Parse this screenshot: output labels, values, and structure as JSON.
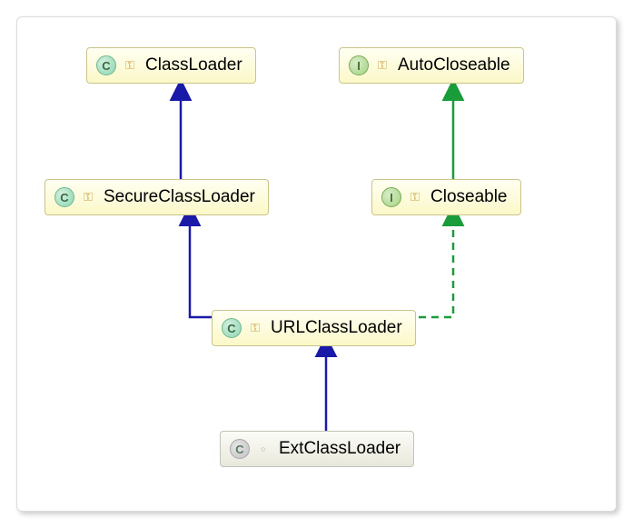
{
  "diagram": {
    "nodes": {
      "classLoader": {
        "kind": "class",
        "modifier": "public",
        "label": "ClassLoader"
      },
      "autoCloseable": {
        "kind": "interface",
        "modifier": "public",
        "label": "AutoCloseable"
      },
      "secureClassLoader": {
        "kind": "class",
        "modifier": "public",
        "label": "SecureClassLoader"
      },
      "closeable": {
        "kind": "interface",
        "modifier": "public",
        "label": "Closeable"
      },
      "urlClassLoader": {
        "kind": "class",
        "modifier": "public",
        "label": "URLClassLoader"
      },
      "extClassLoader": {
        "kind": "class",
        "modifier": "private",
        "label": "ExtClassLoader"
      }
    },
    "edges": [
      {
        "from": "secureClassLoader",
        "to": "classLoader",
        "type": "extends"
      },
      {
        "from": "closeable",
        "to": "autoCloseable",
        "type": "extends"
      },
      {
        "from": "urlClassLoader",
        "to": "secureClassLoader",
        "type": "extends"
      },
      {
        "from": "urlClassLoader",
        "to": "closeable",
        "type": "implements"
      },
      {
        "from": "extClassLoader",
        "to": "urlClassLoader",
        "type": "extends"
      }
    ],
    "colors": {
      "extends": "#1a1aa8",
      "implements": "#1a9c3a"
    }
  },
  "glyphs": {
    "class": "C",
    "interface": "I",
    "public": "⚿",
    "private": "○"
  }
}
